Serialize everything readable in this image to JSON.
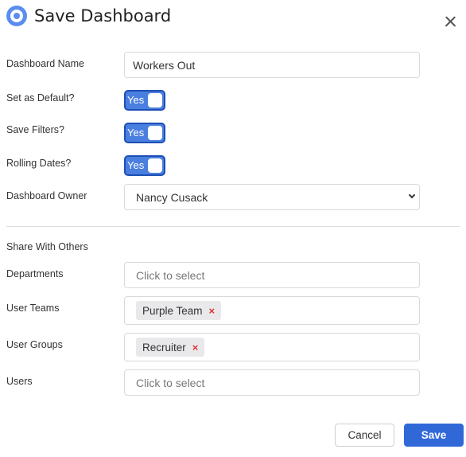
{
  "dialog": {
    "title": "Save Dashboard",
    "logo_icon": "circle-logo-icon",
    "close_icon": "close-icon"
  },
  "form": {
    "dashboard_name": {
      "label": "Dashboard Name",
      "value": "Workers Out"
    },
    "set_as_default": {
      "label": "Set as Default?",
      "toggle_text": "Yes",
      "on": true
    },
    "save_filters": {
      "label": "Save Filters?",
      "toggle_text": "Yes",
      "on": true
    },
    "rolling_dates": {
      "label": "Rolling Dates?",
      "toggle_text": "Yes",
      "on": true
    },
    "dashboard_owner": {
      "label": "Dashboard Owner",
      "value": "Nancy Cusack"
    }
  },
  "share": {
    "section_title": "Share With Others",
    "departments": {
      "label": "Departments",
      "placeholder": "Click to select"
    },
    "user_teams": {
      "label": "User Teams",
      "tags": [
        "Purple Team"
      ]
    },
    "user_groups": {
      "label": "User Groups",
      "tags": [
        "Recruiter"
      ]
    },
    "users": {
      "label": "Users",
      "placeholder": "Click to select"
    },
    "remove_glyph": "×"
  },
  "buttons": {
    "cancel": "Cancel",
    "save": "Save"
  },
  "colors": {
    "primary": "#3168d8",
    "toggle_on": "#4a7fe0",
    "remove": "#e03131",
    "logo": "#5b8def"
  }
}
